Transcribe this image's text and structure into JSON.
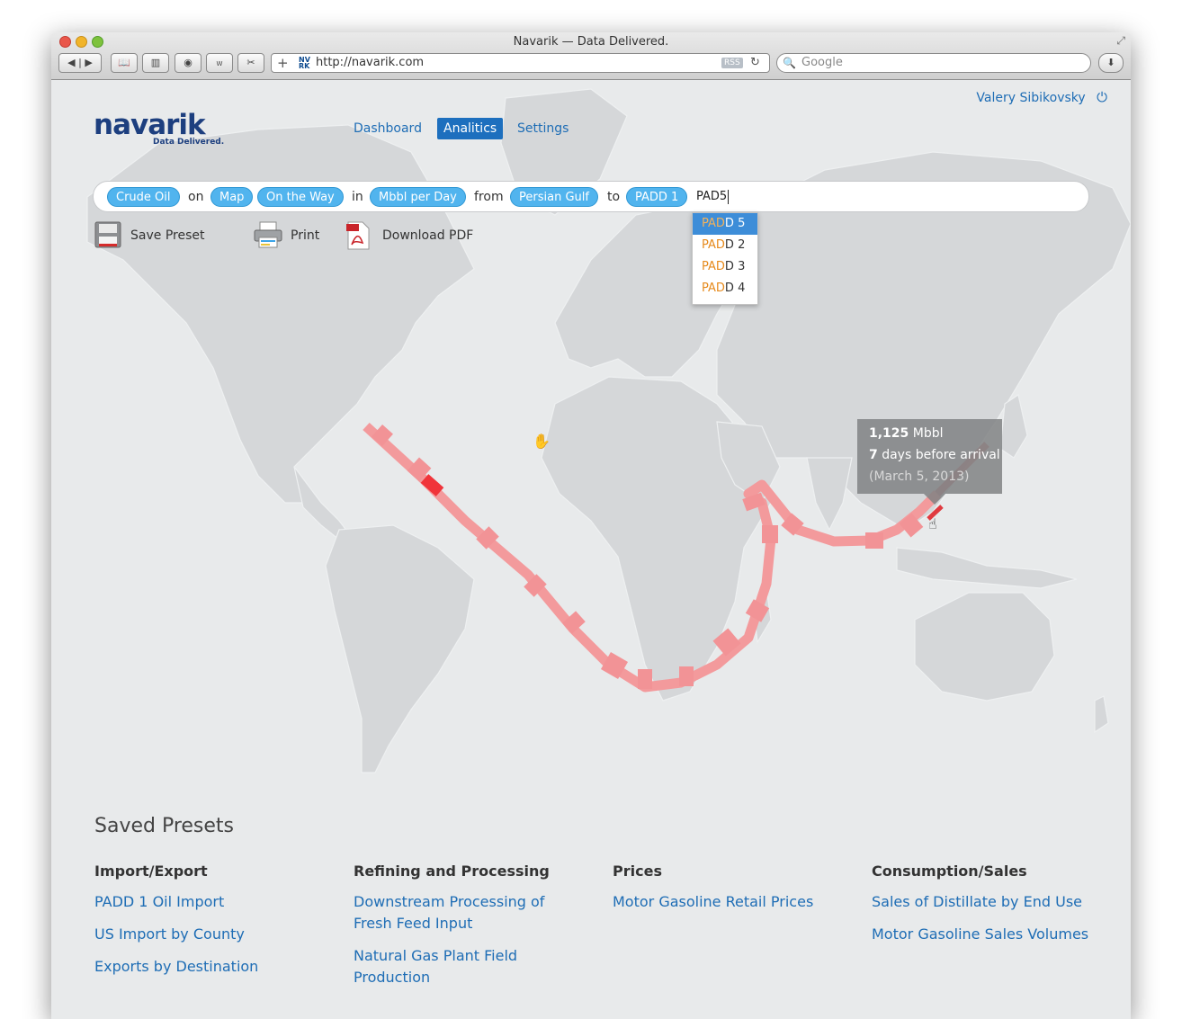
{
  "window": {
    "title": "Navarik — Data Delivered."
  },
  "toolbar": {
    "url": "http://navarik.com",
    "rss_label": "RSS",
    "favicon_text": "NV RK",
    "search_placeholder": "Google"
  },
  "header": {
    "user_name": "Valery Sibikovsky",
    "logo_text": "navarik",
    "logo_tagline": "Data Delivered.",
    "nav": [
      {
        "label": "Dashboard",
        "active": false
      },
      {
        "label": "Analitics",
        "active": true
      },
      {
        "label": "Settings",
        "active": false
      }
    ]
  },
  "query": {
    "tokens": [
      "Crude Oil",
      "Map",
      "On the Way",
      "Mbbl per Day",
      "Persian Gulf",
      "PADD 1"
    ],
    "words": [
      "on",
      "in",
      "from",
      "to"
    ],
    "typed": "PAD5",
    "suggestions": [
      {
        "match": "PAD",
        "rest": "D 5",
        "selected": true
      },
      {
        "match": "PAD",
        "rest": "D 2",
        "selected": false
      },
      {
        "match": "PAD",
        "rest": "D 3",
        "selected": false
      },
      {
        "match": "PAD",
        "rest": "D 4",
        "selected": false
      }
    ]
  },
  "actions": [
    {
      "label": "Save Preset",
      "icon": "floppy-disk-icon"
    },
    {
      "label": "Print",
      "icon": "printer-icon"
    },
    {
      "label": "Download PDF",
      "icon": "pdf-icon"
    }
  ],
  "tooltip": {
    "volume_value": "1,125",
    "volume_unit": "Mbbl",
    "days_value": "7",
    "days_text": "days before arrival",
    "date": "(March 5, 2013)"
  },
  "route": {
    "color": "#f39a9c",
    "highlight_color": "#f0343a"
  },
  "presets": {
    "title": "Saved Presets",
    "columns": [
      {
        "heading": "Import/Export",
        "links": [
          "PADD 1 Oil Import",
          "US Import by County",
          "Exports by Destination"
        ]
      },
      {
        "heading": "Refining and Processing",
        "links": [
          "Downstream Processing of Fresh Feed Input",
          "Natural Gas Plant Field Production"
        ]
      },
      {
        "heading": "Prices",
        "links": [
          "Motor Gasoline Retail Prices"
        ]
      },
      {
        "heading": "Consumption/Sales",
        "links": [
          "Sales of Distillate by End Use",
          "Motor Gasoline Sales Volumes"
        ]
      }
    ]
  },
  "colors": {
    "link": "#1e6db5",
    "token_bg": "#51b4ee",
    "active_nav": "#1d6fbe",
    "match_highlight": "#e68a1c"
  }
}
